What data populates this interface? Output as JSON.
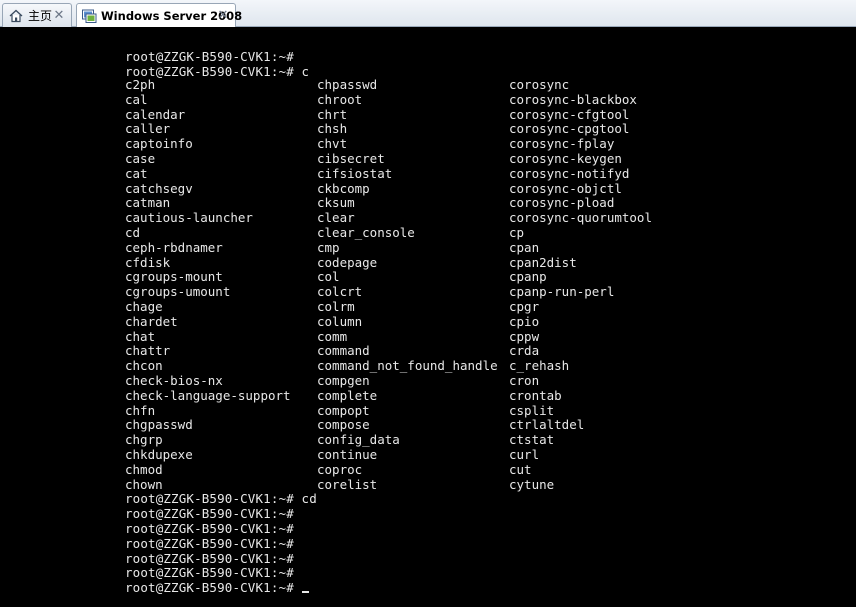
{
  "tabs": [
    {
      "label": "主页",
      "icon": "home-icon"
    },
    {
      "label": "Windows Server 2008",
      "icon": "vm-console-icon"
    }
  ],
  "terminal": {
    "prompt_lines_top": [
      "root@ZZGK-B590-CVK1:~#",
      "root@ZZGK-B590-CVK1:~# c"
    ],
    "completions": {
      "col1": [
        "c2ph",
        "cal",
        "calendar",
        "caller",
        "captoinfo",
        "case",
        "cat",
        "catchsegv",
        "catman",
        "cautious-launcher",
        "cd",
        "ceph-rbdnamer",
        "cfdisk",
        "cgroups-mount",
        "cgroups-umount",
        "chage",
        "chardet",
        "chat",
        "chattr",
        "chcon",
        "check-bios-nx",
        "check-language-support",
        "chfn",
        "chgpasswd",
        "chgrp",
        "chkdupexe",
        "chmod",
        "chown"
      ],
      "col2": [
        "chpasswd",
        "chroot",
        "chrt",
        "chsh",
        "chvt",
        "cibsecret",
        "cifsiostat",
        "ckbcomp",
        "cksum",
        "clear",
        "clear_console",
        "cmp",
        "codepage",
        "col",
        "colcrt",
        "colrm",
        "column",
        "comm",
        "command",
        "command_not_found_handle",
        "compgen",
        "complete",
        "compopt",
        "compose",
        "config_data",
        "continue",
        "coproc",
        "corelist"
      ],
      "col3": [
        "corosync",
        "corosync-blackbox",
        "corosync-cfgtool",
        "corosync-cpgtool",
        "corosync-fplay",
        "corosync-keygen",
        "corosync-notifyd",
        "corosync-objctl",
        "corosync-pload",
        "corosync-quorumtool",
        "cp",
        "cpan",
        "cpan2dist",
        "cpanp",
        "cpanp-run-perl",
        "cpgr",
        "cpio",
        "cppw",
        "crda",
        "c_rehash",
        "cron",
        "crontab",
        "csplit",
        "ctrlaltdel",
        "ctstat",
        "curl",
        "cut",
        "cytune"
      ]
    },
    "prompt_lines_bottom": [
      "root@ZZGK-B590-CVK1:~# cd",
      "root@ZZGK-B590-CVK1:~#",
      "root@ZZGK-B590-CVK1:~#",
      "root@ZZGK-B590-CVK1:~#",
      "root@ZZGK-B590-CVK1:~#",
      "root@ZZGK-B590-CVK1:~#",
      "root@ZZGK-B590-CVK1:~#"
    ]
  },
  "colors": {
    "terminal_bg": "#000000",
    "terminal_fg": "#e8e8e8",
    "tabbar_bg": "#dfe6ee"
  }
}
